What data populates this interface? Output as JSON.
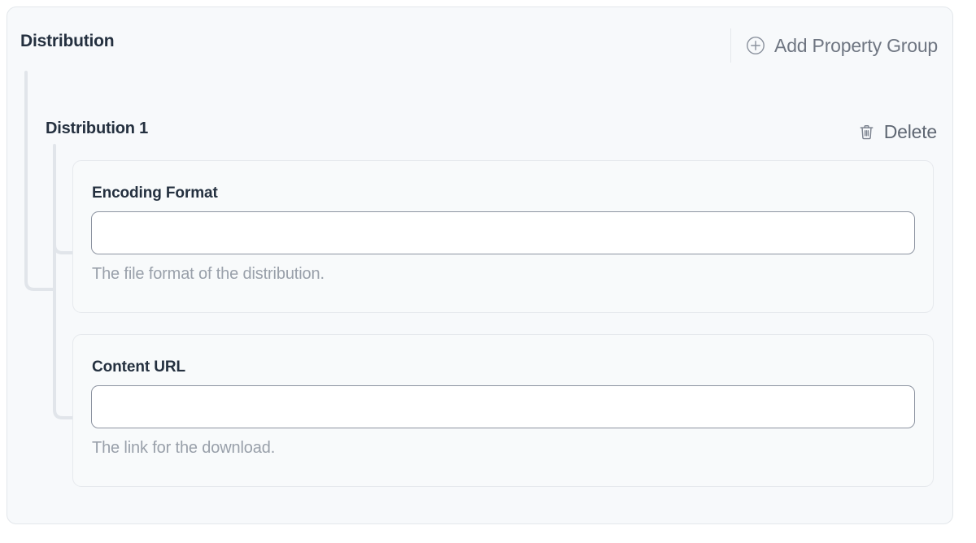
{
  "group": {
    "title": "Distribution",
    "add_button": {
      "label": "Add Property Group",
      "icon": "plus-circle-icon"
    }
  },
  "subgroup": {
    "title": "Distribution 1",
    "delete_button": {
      "label": "Delete",
      "icon": "trash-icon"
    }
  },
  "fields": [
    {
      "label": "Encoding Format",
      "value": "",
      "placeholder": "",
      "help": "The file format of the distribution."
    },
    {
      "label": "Content URL",
      "value": "",
      "placeholder": "",
      "help": "The link for the download."
    }
  ],
  "colors": {
    "panel_bg": "#f7f9fb",
    "panel_border": "#e3e7eb",
    "card_bg": "#f8fafb",
    "card_border": "#e6e9ed",
    "input_bg": "#ffffff",
    "input_border": "#8d94a1",
    "heading_text": "#24303f",
    "muted_text": "#99a0aa",
    "action_text": "#6f7682",
    "tree_line": "#e1e5ea"
  }
}
